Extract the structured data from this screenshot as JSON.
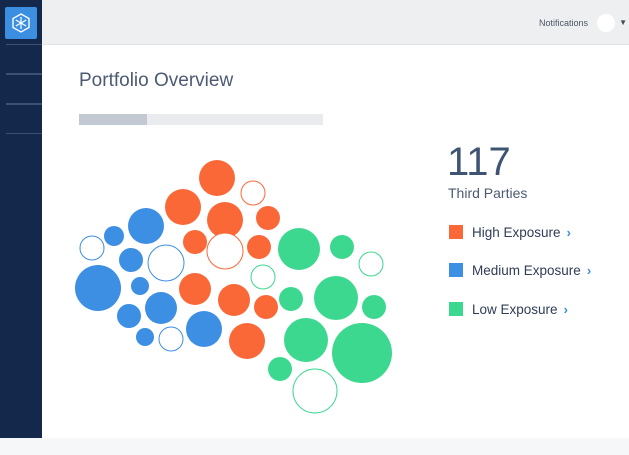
{
  "header": {
    "notifications_label": "Notifications",
    "avatar_icon": "user-avatar",
    "dropdown_icon": "chevron-down-icon"
  },
  "sidebar": {
    "logo_icon": "snowflake-icon",
    "items": [
      {
        "icon": "nav-item-1"
      },
      {
        "icon": "nav-item-2"
      },
      {
        "icon": "nav-item-3"
      }
    ]
  },
  "main": {
    "title": "Portfolio Overview",
    "progress": 0.28,
    "count": "117",
    "count_label": "Third Parties"
  },
  "legend": [
    {
      "label": "High Exposure",
      "color": "#fb6837",
      "chevron": "›"
    },
    {
      "label": "Medium Exposure",
      "color": "#3d8fe3",
      "chevron": "›"
    },
    {
      "label": "Low Exposure",
      "color": "#3dd88f",
      "chevron": "›"
    }
  ],
  "colors": {
    "high": "#fb6837",
    "medium": "#3d8fe3",
    "low": "#3dd88f",
    "sidebar": "#14284b",
    "accent": "#3b8ee0"
  }
}
